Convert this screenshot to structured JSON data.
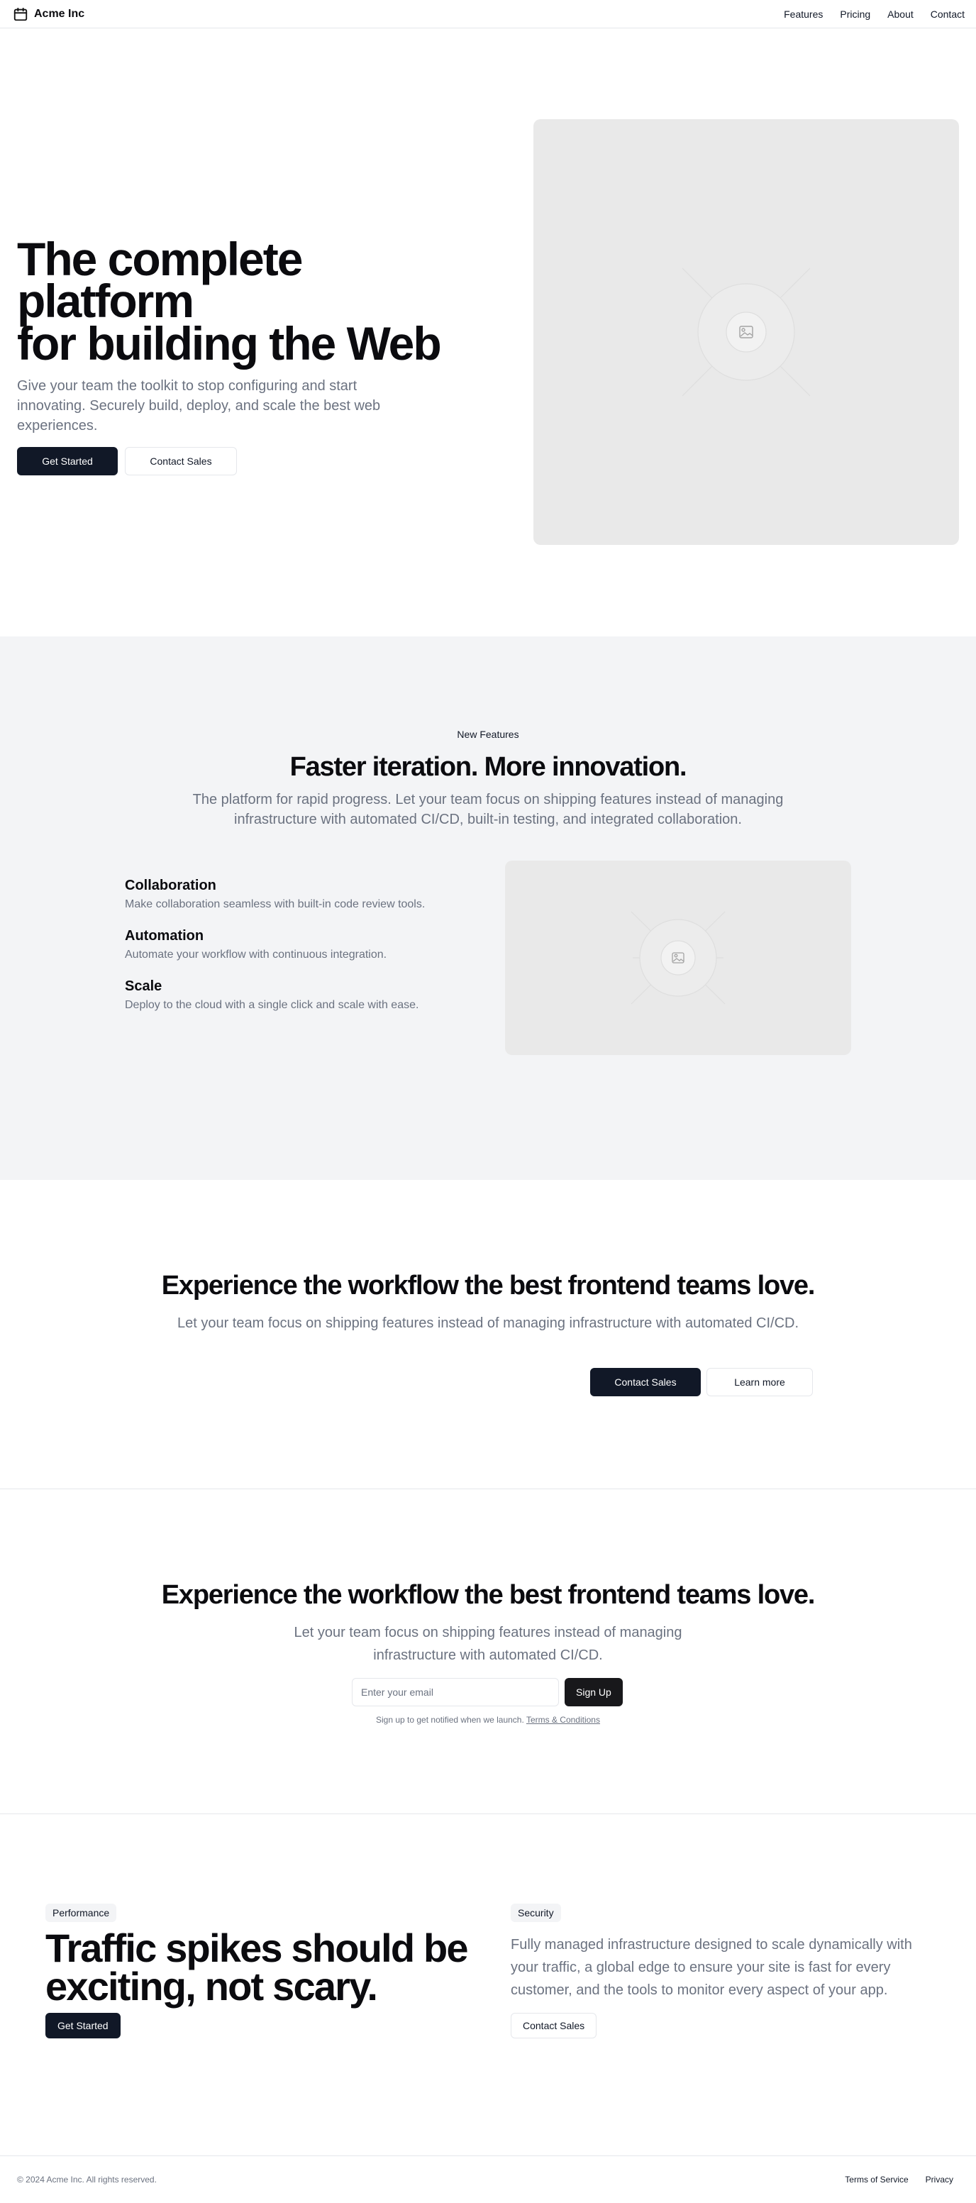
{
  "header": {
    "brand": "Acme Inc",
    "nav": [
      "Features",
      "Pricing",
      "About",
      "Contact"
    ]
  },
  "hero": {
    "title_line1": "The complete platform",
    "title_line2": "for building the Web",
    "subtitle": "Give your team the toolkit to stop configuring and start innovating. Securely build, deploy, and scale the best web experiences.",
    "primary_button": "Get Started",
    "secondary_button": "Contact Sales"
  },
  "features": {
    "eyebrow": "New Features",
    "title": "Faster iteration. More innovation.",
    "subtitle": "The platform for rapid progress. Let your team focus on shipping features instead of managing infrastructure with automated CI/CD, built-in testing, and integrated collaboration.",
    "items": [
      {
        "title": "Collaboration",
        "description": "Make collaboration seamless with built-in code review tools."
      },
      {
        "title": "Automation",
        "description": "Automate your workflow with continuous integration."
      },
      {
        "title": "Scale",
        "description": "Deploy to the cloud with a single click and scale with ease."
      }
    ]
  },
  "cta": {
    "title": "Experience the workflow the best frontend teams love.",
    "subtitle": "Let your team focus on shipping features instead of managing infrastructure with automated CI/CD.",
    "primary_button": "Contact Sales",
    "secondary_button": "Learn more"
  },
  "newsletter": {
    "title": "Experience the workflow the best frontend teams love.",
    "subtitle": "Let your team focus on shipping features instead of managing infrastructure with automated CI/CD.",
    "email_placeholder": "Enter your email",
    "button": "Sign Up",
    "note": "Sign up to get notified when we launch.",
    "note_link": "Terms & Conditions"
  },
  "performance": {
    "badge_left": "Performance",
    "title": "Traffic spikes should be exciting, not scary.",
    "left_button": "Get Started",
    "badge_right": "Security",
    "text": "Fully managed infrastructure designed to scale dynamically with your traffic, a global edge to ensure your site is fast for every customer, and the tools to monitor every aspect of your app.",
    "right_button": "Contact Sales"
  },
  "footer": {
    "copyright": "© 2024 Acme Inc. All rights reserved.",
    "links": [
      "Terms of Service",
      "Privacy"
    ]
  },
  "colors": {
    "primary_dark": "#111827",
    "muted_text": "#6b7280",
    "section_bg": "#f3f4f6",
    "placeholder_bg": "#e9e9e9"
  }
}
